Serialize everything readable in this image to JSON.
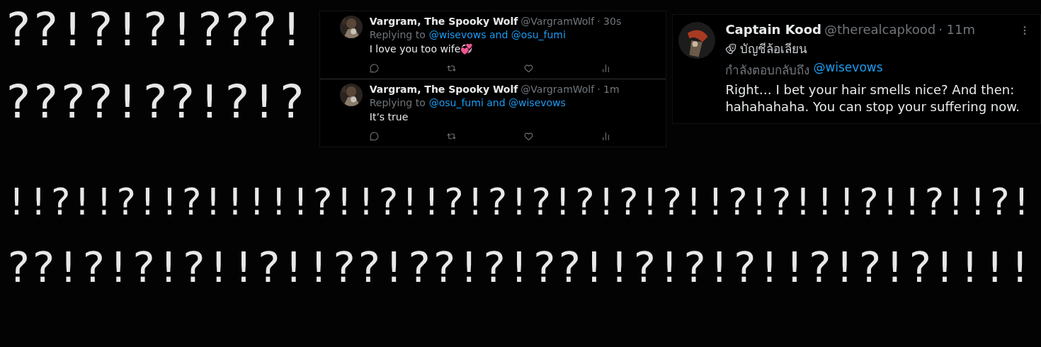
{
  "background_rows": [
    {
      "text": "??!?!?!???!"
    },
    {
      "text": "????!??!?!?"
    },
    {
      "text": "!!?!!?!!?!!!!!?!!?!!?!?!?!?!?!?!!?!?!!!?!!?!!?!"
    },
    {
      "text": "??!?!?!?!!?!!??!??!?!??!!?!?!?!!?!?!?!!!!"
    }
  ],
  "thread": {
    "tweets": [
      {
        "name": "Vargram, The Spooky Wolf",
        "handle": "@VargramWolf",
        "time": "· 30s",
        "reply_prefix": "Replying to",
        "reply_to": "@wisevows and @osu_fumi",
        "text": "I love you too wife💞"
      },
      {
        "name": "Vargram, The Spooky Wolf",
        "handle": "@VargramWolf",
        "time": "· 1m",
        "reply_prefix": "Replying to",
        "reply_to": "@osu_fumi and @wisevows",
        "text": "It’s true"
      }
    ]
  },
  "reply_tweet": {
    "name": "Captain Kood",
    "handle": "@therealcapkood",
    "time": "· 11m",
    "label": "บัญชีล้อเลียน",
    "reply_prefix": "กำลังตอบกลับถึง",
    "reply_to": "@wisevows",
    "text": "Right… I bet your hair smells nice? And then: hahahahaha. You can stop your suffering now."
  }
}
